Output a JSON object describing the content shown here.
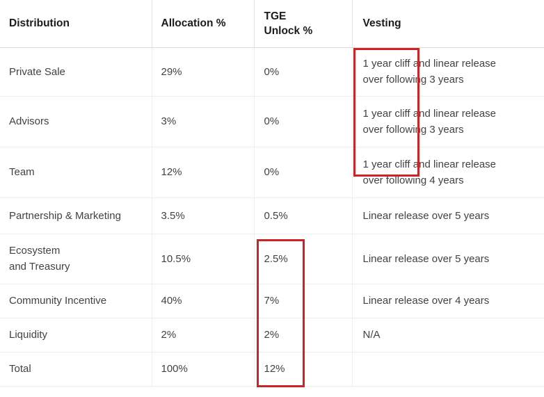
{
  "table": {
    "columns": [
      {
        "key": "distribution",
        "label": "Distribution"
      },
      {
        "key": "allocation",
        "label": "Allocation %"
      },
      {
        "key": "tge_unlock",
        "label_line1": "TGE",
        "label_line2": "Unlock %"
      },
      {
        "key": "vesting",
        "label": "Vesting"
      }
    ],
    "rows": [
      {
        "distribution": "Private Sale",
        "allocation": "29%",
        "tge_unlock": "0%",
        "vesting_line1": "1 year cliff and linear release",
        "vesting_line2": "over following 3 years"
      },
      {
        "distribution": "Advisors",
        "allocation": "3%",
        "tge_unlock": "0%",
        "vesting_line1": "1 year cliff and linear release",
        "vesting_line2": "over following 3 years"
      },
      {
        "distribution": "Team",
        "allocation": "12%",
        "tge_unlock": "0%",
        "vesting_line1": "1 year cliff and linear release",
        "vesting_line2": "over following 4 years"
      },
      {
        "distribution": "Partnership & Marketing",
        "allocation": "3.5%",
        "tge_unlock": "0.5%",
        "vesting_line1": "Linear release over 5 years",
        "vesting_line2": ""
      },
      {
        "distribution_line1": "Ecosystem",
        "distribution_line2": "and Treasury",
        "allocation": "10.5%",
        "tge_unlock": "2.5%",
        "vesting_line1": "Linear release over 5 years",
        "vesting_line2": ""
      },
      {
        "distribution": "Community Incentive",
        "allocation": "40%",
        "tge_unlock": "7%",
        "vesting_line1": "Linear release over 4 years",
        "vesting_line2": ""
      },
      {
        "distribution": "Liquidity",
        "allocation": "2%",
        "tge_unlock": "2%",
        "vesting_line1": "N/A",
        "vesting_line2": ""
      },
      {
        "distribution": "Total",
        "allocation": "100%",
        "tge_unlock": "12%",
        "vesting_line1": "",
        "vesting_line2": ""
      }
    ]
  },
  "annotations": {
    "color": "#cd2327",
    "boxes": [
      {
        "name": "vesting-cliff-highlight",
        "target": "vesting cliff terms rows 1-3"
      },
      {
        "name": "tge-values-highlight",
        "target": "TGE unlock values rows 5-8"
      }
    ]
  },
  "colors": {
    "header_text": "#1b1b1b",
    "body_text": "#3f4246",
    "grid_line": "#ececec",
    "header_rule": "#dcdcdc",
    "background": "#ffffff",
    "annotation_red": "#cd2327"
  }
}
